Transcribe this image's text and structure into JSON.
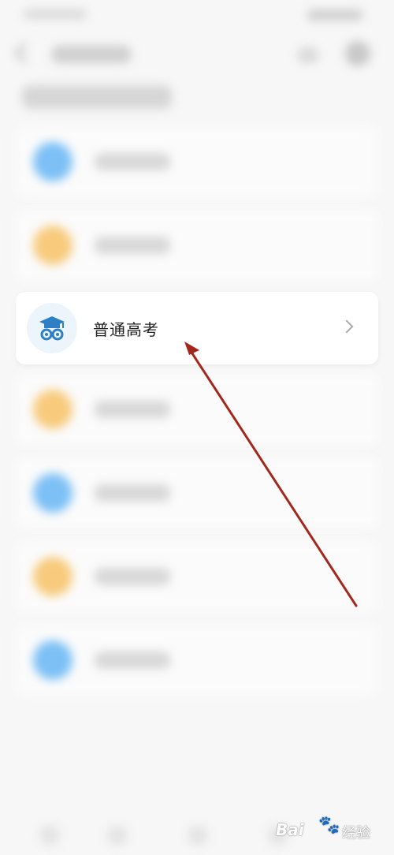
{
  "list": {
    "highlighted_item": {
      "label": "普通高考",
      "icon": "graduation-cap-owl-icon"
    },
    "blurred_item_icon_colors": [
      "#7cc0f6",
      "#f8cb7c",
      "#f8cb7c",
      "#7cc0f6",
      "#f8cb7c",
      "#7cc0f6"
    ]
  },
  "annotation": {
    "arrow_color": "#a3271b"
  },
  "watermark": {
    "brand": "Bai",
    "brand_suffix": "经验",
    "icon": "paw-icon"
  },
  "colors": {
    "accent": "#2f7fc4",
    "background": "#f7f7f7"
  }
}
